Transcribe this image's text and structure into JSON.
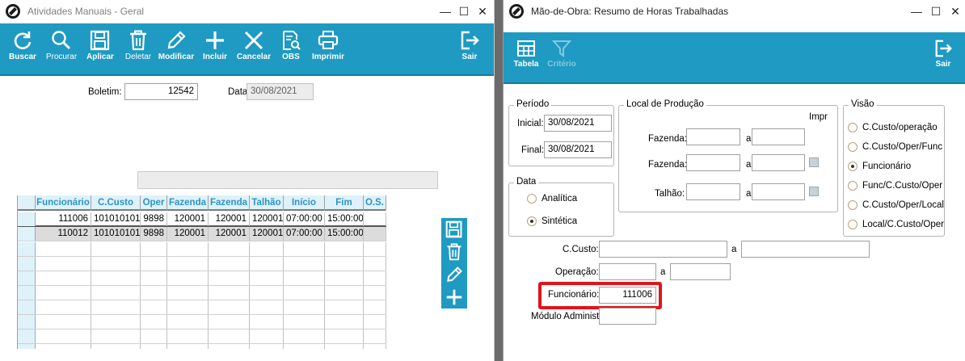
{
  "left_window": {
    "title": "Atividades Manuais - Geral",
    "toolbar": [
      {
        "id": "buscar",
        "label": "Buscar",
        "icon": "refresh-icon"
      },
      {
        "id": "procurar",
        "label": "Procurar",
        "icon": "search-icon"
      },
      {
        "id": "aplicar",
        "label": "Aplicar",
        "icon": "save-icon"
      },
      {
        "id": "deletar",
        "label": "Deletar",
        "icon": "trash-icon"
      },
      {
        "id": "modificar",
        "label": "Modificar",
        "icon": "pencil-icon"
      },
      {
        "id": "incluir",
        "label": "Incluir",
        "icon": "plus-icon"
      },
      {
        "id": "cancelar",
        "label": "Cancelar",
        "icon": "close-icon"
      },
      {
        "id": "obs",
        "label": "OBS",
        "icon": "document-search-icon"
      },
      {
        "id": "imprimir",
        "label": "Imprimir",
        "icon": "printer-icon"
      },
      {
        "id": "sair",
        "label": "Sair",
        "icon": "exit-icon"
      }
    ],
    "boletim_label": "Boletim:",
    "boletim_value": "12542",
    "data_label": "Data:",
    "data_value": "30/08/2021",
    "grid": {
      "columns": [
        "Funcionário",
        "C.Custo",
        "Oper",
        "Fazenda",
        "Fazenda",
        "Talhão",
        "Início",
        "Fim",
        "O.S."
      ],
      "rows": [
        [
          "111006",
          "101010101",
          "9898",
          "120001",
          "120001",
          "120001",
          "07:00:00",
          "15:00:00",
          ""
        ],
        [
          "110012",
          "101010101",
          "9898",
          "120001",
          "120001",
          "120001",
          "07:00:00",
          "15:00:00",
          ""
        ]
      ]
    }
  },
  "right_window": {
    "title": "Mão-de-Obra: Resumo de Horas Trabalhadas",
    "toolbar": [
      {
        "id": "tabela",
        "label": "Tabela",
        "icon": "table-icon",
        "enabled": true
      },
      {
        "id": "criterio",
        "label": "Critério",
        "icon": "filter-icon",
        "enabled": false
      },
      {
        "id": "sair",
        "label": "Sair",
        "icon": "exit-icon",
        "enabled": true
      }
    ],
    "periodo": {
      "title": "Período",
      "inicial_label": "Inicial:",
      "inicial_value": "30/08/2021",
      "final_label": "Final:",
      "final_value": "30/08/2021"
    },
    "data_group": {
      "title": "Data",
      "options": [
        {
          "label": "Analítica",
          "selected": false
        },
        {
          "label": "Sintética",
          "selected": true
        }
      ]
    },
    "local_producao": {
      "title": "Local de Produção",
      "impr_label": "Impr",
      "a_label": "a",
      "rows": [
        {
          "label": "Fazenda:",
          "from": "",
          "to": ""
        },
        {
          "label": "Fazenda:",
          "from": "",
          "to": ""
        },
        {
          "label": "Talhão:",
          "from": "",
          "to": ""
        }
      ]
    },
    "visao": {
      "title": "Visão",
      "options": [
        {
          "label": "C.Custo/operação",
          "selected": false
        },
        {
          "label": "C.Custo/Oper/Func",
          "selected": false
        },
        {
          "label": "Funcionário",
          "selected": true
        },
        {
          "label": "Func/C.Custo/Oper",
          "selected": false
        },
        {
          "label": "C.Custo/Oper/Local",
          "selected": false
        },
        {
          "label": "Local/C.Custo/Oper",
          "selected": false
        }
      ]
    },
    "filters": {
      "a_label": "a",
      "ccusto_label": "C.Custo:",
      "operacao_label": "Operação:",
      "funcionario_label": "Funcionário:",
      "funcionario_value": "111006",
      "modulo_label": "Módulo Administ:"
    },
    "highlight_color": "#e0151c"
  },
  "accent_color": "#1f9ac2"
}
